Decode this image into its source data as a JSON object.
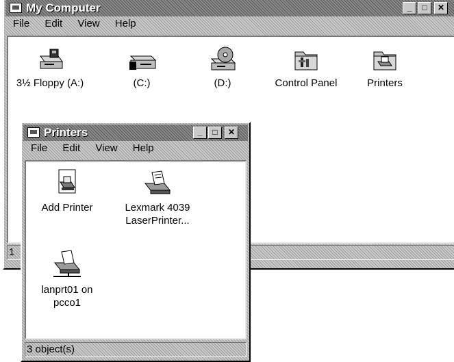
{
  "my_computer": {
    "title": "My Computer",
    "menu": [
      "File",
      "Edit",
      "View",
      "Help"
    ],
    "items": [
      {
        "label": "3½ Floppy (A:)",
        "icon": "floppy-drive-icon"
      },
      {
        "label": "(C:)",
        "icon": "hard-drive-icon"
      },
      {
        "label": "(D:)",
        "icon": "cd-drive-icon"
      },
      {
        "label": "Control Panel",
        "icon": "control-panel-folder-icon"
      },
      {
        "label": "Printers",
        "icon": "printers-folder-icon"
      }
    ],
    "status_fragment": "1"
  },
  "printers": {
    "title": "Printers",
    "menu": [
      "File",
      "Edit",
      "View",
      "Help"
    ],
    "items": [
      {
        "label_line1": "Add Printer",
        "label_line2": "",
        "icon": "add-printer-icon"
      },
      {
        "label_line1": "Lexmark 4039",
        "label_line2": "LaserPrinter...",
        "icon": "printer-icon"
      },
      {
        "label_line1": "lanprt01 on",
        "label_line2": "pcco1",
        "icon": "network-printer-icon"
      }
    ],
    "status": "3 object(s)"
  },
  "window_buttons": {
    "minimize": "_",
    "maximize": "□",
    "close": "✕"
  }
}
